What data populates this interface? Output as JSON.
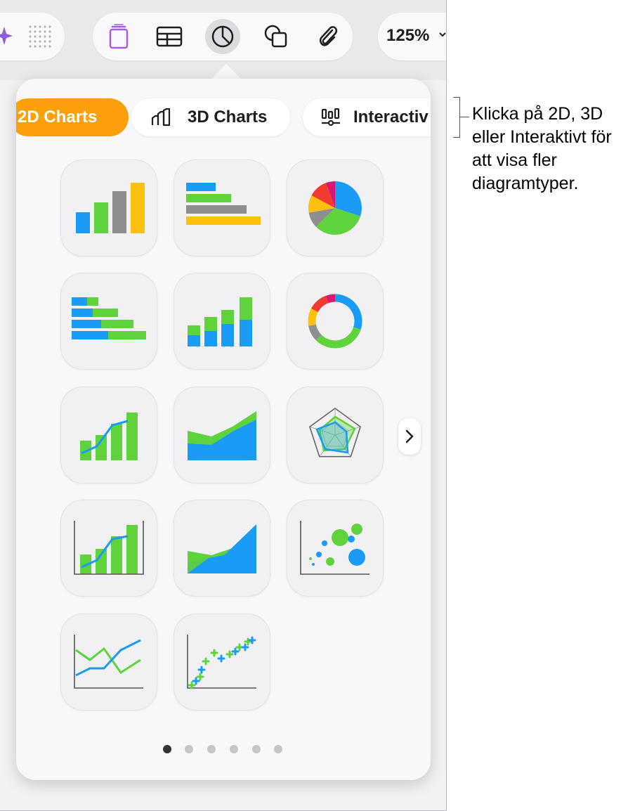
{
  "toolbar": {
    "zoom": "125%",
    "icons": [
      "ai-sparkle-icon",
      "dot-grid-icon",
      "document-icon",
      "table-icon",
      "chart-icon",
      "shapes-icon",
      "attachment-icon"
    ]
  },
  "tabs": [
    {
      "label": "2D Charts",
      "selected": true
    },
    {
      "label": "3D Charts",
      "selected": false,
      "icon": "3d-bar-chart-icon"
    },
    {
      "label": "Interactiv",
      "selected": false,
      "icon": "interactive-slider-icon"
    }
  ],
  "chart_types": [
    "column-chart",
    "bar-chart",
    "pie-chart",
    "stacked-bar-chart",
    "stacked-column-chart",
    "donut-chart",
    "mixed-chart",
    "area-chart",
    "radar-chart",
    "two-axis-chart",
    "stacked-area-chart",
    "bubble-chart",
    "line-chart",
    "scatter-chart"
  ],
  "pagination": {
    "pages": 6,
    "current": 1
  },
  "callout": {
    "text": "Klicka på 2D, 3D eller Interaktivt för att visa fler diagramtyper."
  },
  "colors": {
    "accent": "#fb9f0a",
    "blue": "#1a9bf5",
    "green": "#5fd33b",
    "gray": "#8e8e8e",
    "yellow": "#fdc00e",
    "red": "#f23b2f",
    "magenta": "#d9186e"
  }
}
